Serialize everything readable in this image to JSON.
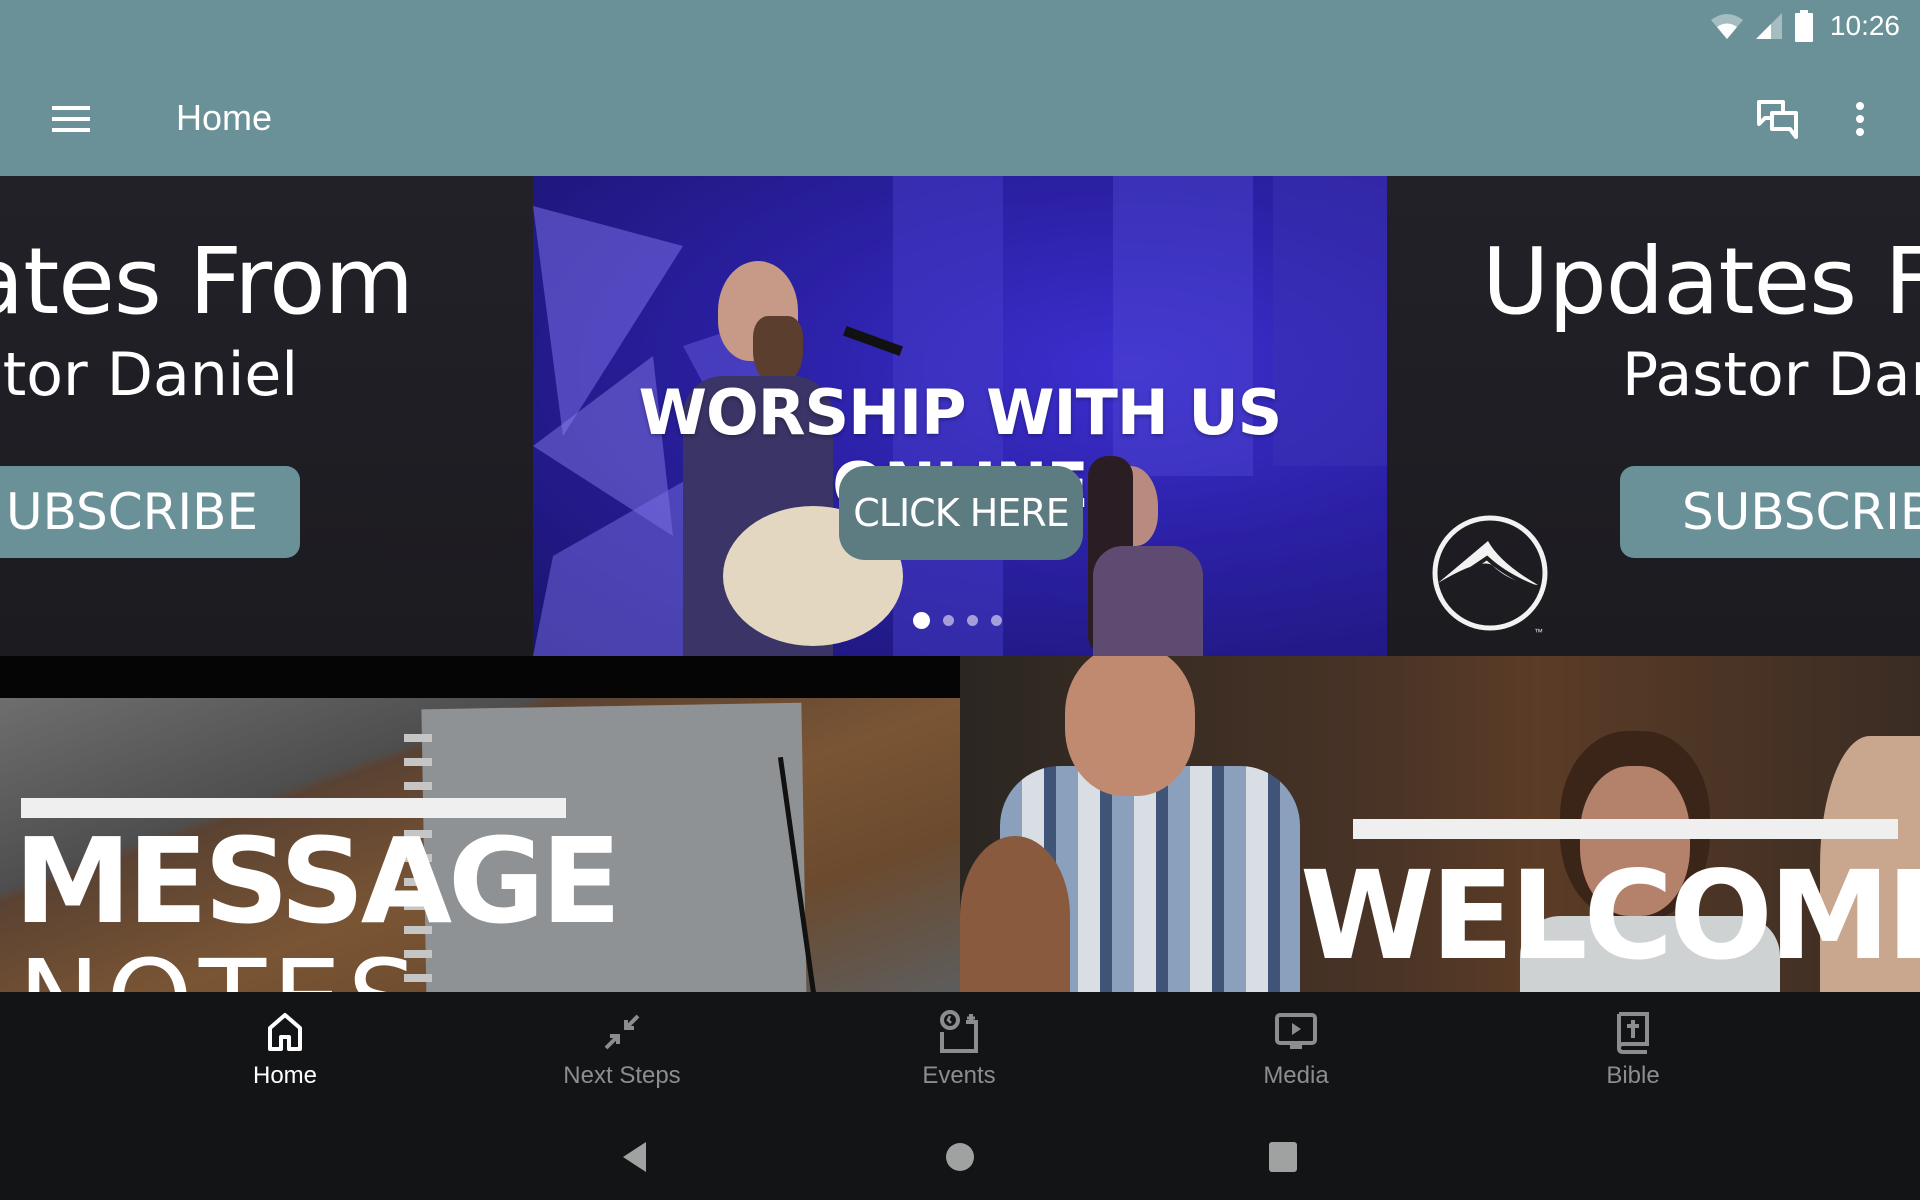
{
  "status_bar": {
    "time": "10:26",
    "icons": [
      "wifi-icon",
      "cell-signal-icon",
      "battery-icon"
    ]
  },
  "toolbar": {
    "title": "Home",
    "menu_icon": "hamburger-menu-icon",
    "actions": [
      "chat-bubbles-icon",
      "more-vertical-icon"
    ]
  },
  "carousel": {
    "slides": [
      {
        "title": "Updates From",
        "subtitle": "Pastor Daniel",
        "button_label": "SUBSCRIBE"
      },
      {
        "title": "WORSHIP WITH US ONLINE",
        "button_label": "CLICK HERE"
      },
      {
        "title": "Updates From",
        "subtitle": "Pastor Daniel",
        "button_label": "SUBSCRIBE",
        "logo_mark": "™"
      }
    ],
    "left_partial": {
      "title": "ates From",
      "subtitle": "stor Daniel",
      "button_label": "UBSCRIBE"
    },
    "right_partial": {
      "title": "Updates F",
      "subtitle": "Pastor Dar",
      "button_label": "SUBSCRIB"
    },
    "page_count": 4,
    "active_page": 1
  },
  "tiles": [
    {
      "title": "MESSAGE",
      "subtitle": "NOTES"
    },
    {
      "title": "WELCOME"
    }
  ],
  "bottom_nav": {
    "items": [
      {
        "label": "Home",
        "icon": "home-icon",
        "active": true
      },
      {
        "label": "Next Steps",
        "icon": "arrows-inward-icon",
        "active": false
      },
      {
        "label": "Events",
        "icon": "calendar-clock-icon",
        "active": false
      },
      {
        "label": "Media",
        "icon": "play-screen-icon",
        "active": false
      },
      {
        "label": "Bible",
        "icon": "bible-icon",
        "active": false
      }
    ]
  },
  "system_nav": [
    "back-icon",
    "home-circle-icon",
    "recents-icon"
  ],
  "colors": {
    "primary": "#6a9198",
    "nav_background": "#131416",
    "inactive_label": "#8c8d8f",
    "slide_purple": "#2c21a8"
  }
}
